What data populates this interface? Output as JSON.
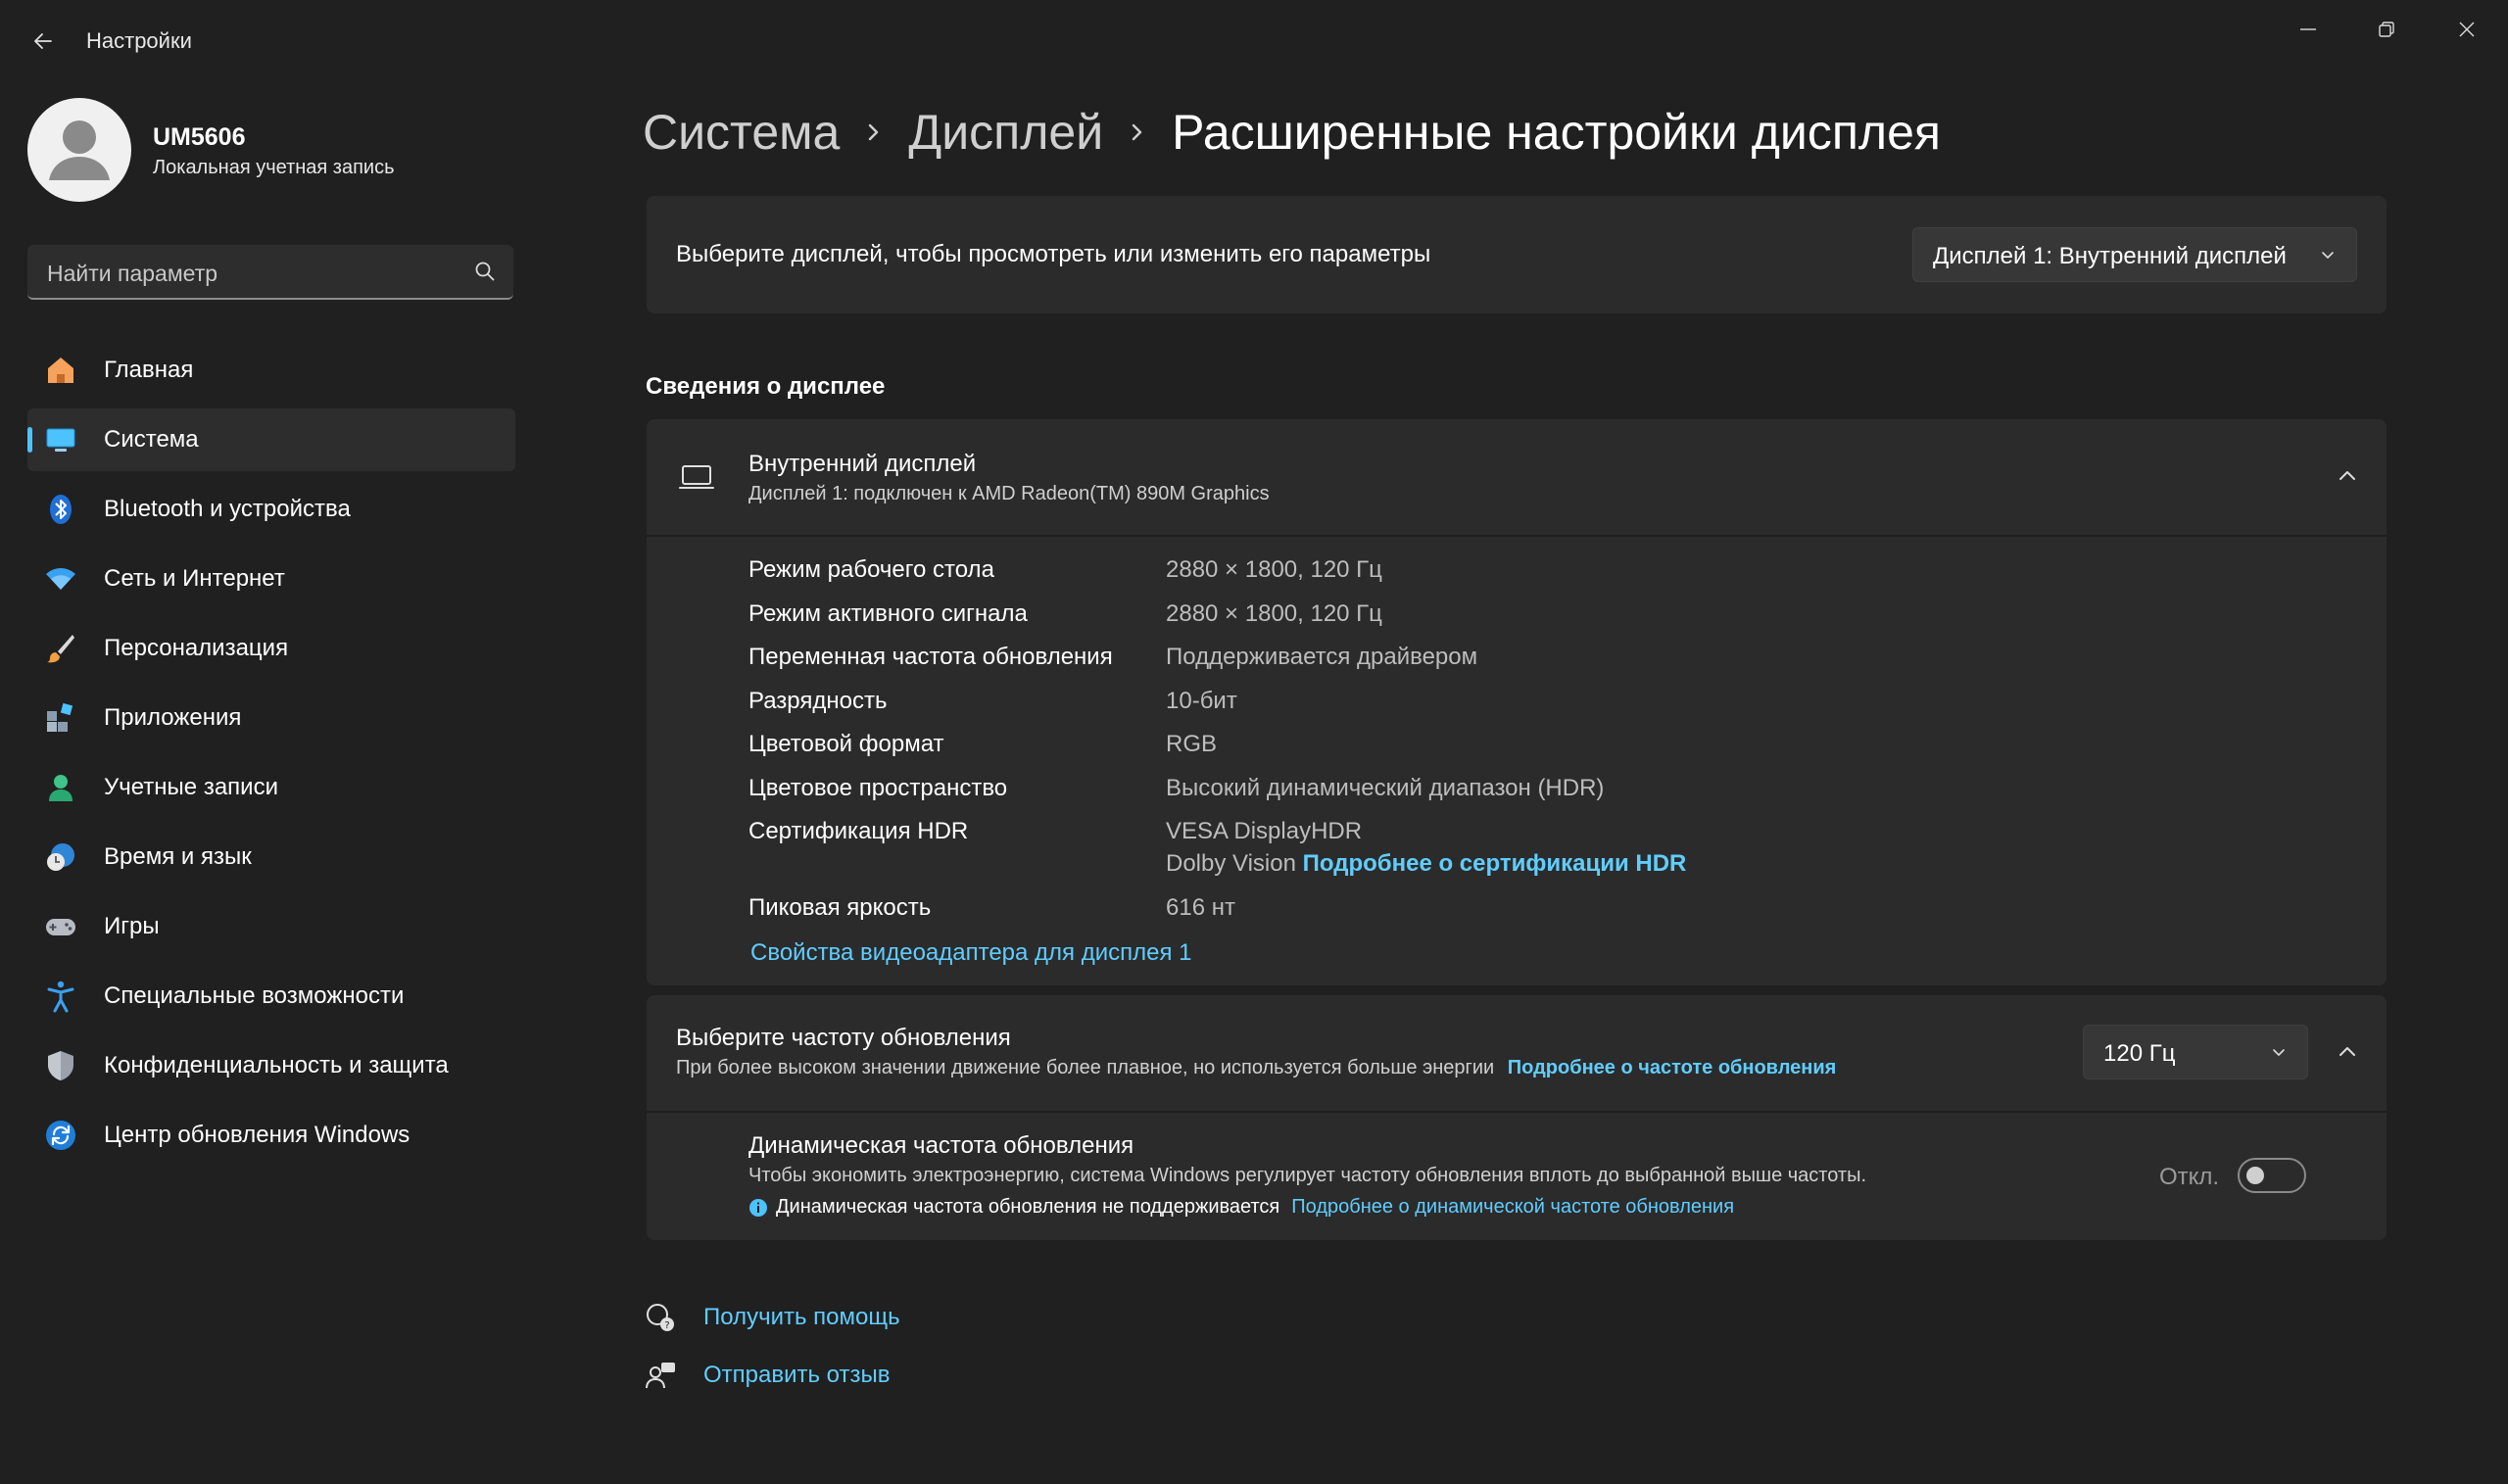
{
  "app": {
    "title": "Настройки"
  },
  "user": {
    "name": "UM5606",
    "account_type": "Локальная учетная запись"
  },
  "search": {
    "placeholder": "Найти параметр"
  },
  "sidebar": {
    "items": [
      {
        "label": "Главная",
        "icon": "home-icon"
      },
      {
        "label": "Система",
        "icon": "system-icon",
        "active": true
      },
      {
        "label": "Bluetooth и устройства",
        "icon": "bluetooth-icon"
      },
      {
        "label": "Сеть и Интернет",
        "icon": "wifi-icon"
      },
      {
        "label": "Персонализация",
        "icon": "brush-icon"
      },
      {
        "label": "Приложения",
        "icon": "apps-icon"
      },
      {
        "label": "Учетные записи",
        "icon": "account-icon"
      },
      {
        "label": "Время и язык",
        "icon": "time-language-icon"
      },
      {
        "label": "Игры",
        "icon": "gamepad-icon"
      },
      {
        "label": "Специальные возможности",
        "icon": "accessibility-icon"
      },
      {
        "label": "Конфиденциальность и защита",
        "icon": "shield-icon"
      },
      {
        "label": "Центр обновления Windows",
        "icon": "update-icon"
      }
    ]
  },
  "breadcrumb": {
    "level1": "Система",
    "level2": "Дисплей",
    "current": "Расширенные настройки дисплея"
  },
  "display_select": {
    "label": "Выберите дисплей, чтобы просмотреть или изменить его параметры",
    "selected": "Дисплей 1: Внутренний дисплей"
  },
  "info": {
    "section_title": "Сведения о дисплее",
    "title": "Внутренний дисплей",
    "subtitle": "Дисплей 1: подключен к AMD Radeon(TM) 890M Graphics",
    "props": [
      {
        "label": "Режим рабочего стола",
        "value": "2880 × 1800, 120 Гц"
      },
      {
        "label": "Режим активного сигнала",
        "value": "2880 × 1800, 120 Гц"
      },
      {
        "label": "Переменная частота обновления",
        "value": "Поддерживается драйвером"
      },
      {
        "label": "Разрядность",
        "value": "10-бит"
      },
      {
        "label": "Цветовой формат",
        "value": "RGB"
      },
      {
        "label": "Цветовое пространство",
        "value": "Высокий динамический диапазон (HDR)"
      },
      {
        "label": "Сертификация HDR",
        "value": "VESA DisplayHDR",
        "value2": "Dolby Vision",
        "link": "Подробнее о сертификации HDR"
      },
      {
        "label": "Пиковая яркость",
        "value": "616 нт"
      }
    ],
    "adapter_link": "Свойства видеоадаптера для дисплея 1"
  },
  "refresh": {
    "title": "Выберите частоту обновления",
    "subtitle": "При более высоком значении движение более плавное, но используется больше энергии",
    "link": "Подробнее о частоте обновления",
    "selected": "120 Гц",
    "dynamic": {
      "title": "Динамическая частота обновления",
      "subtitle": "Чтобы экономить электроэнергию, система Windows регулирует частоту обновления вплоть до выбранной выше частоты.",
      "warning": "Динамическая частота обновления не поддерживается",
      "link": "Подробнее о динамической частоте обновления",
      "toggle_state": "Откл.",
      "enabled": false
    }
  },
  "footer": {
    "help": "Получить помощь",
    "feedback": "Отправить отзыв"
  },
  "colors": {
    "accent": "#4cc2ff",
    "link": "#60cdff",
    "background": "#202020",
    "card": "#2b2b2b"
  }
}
